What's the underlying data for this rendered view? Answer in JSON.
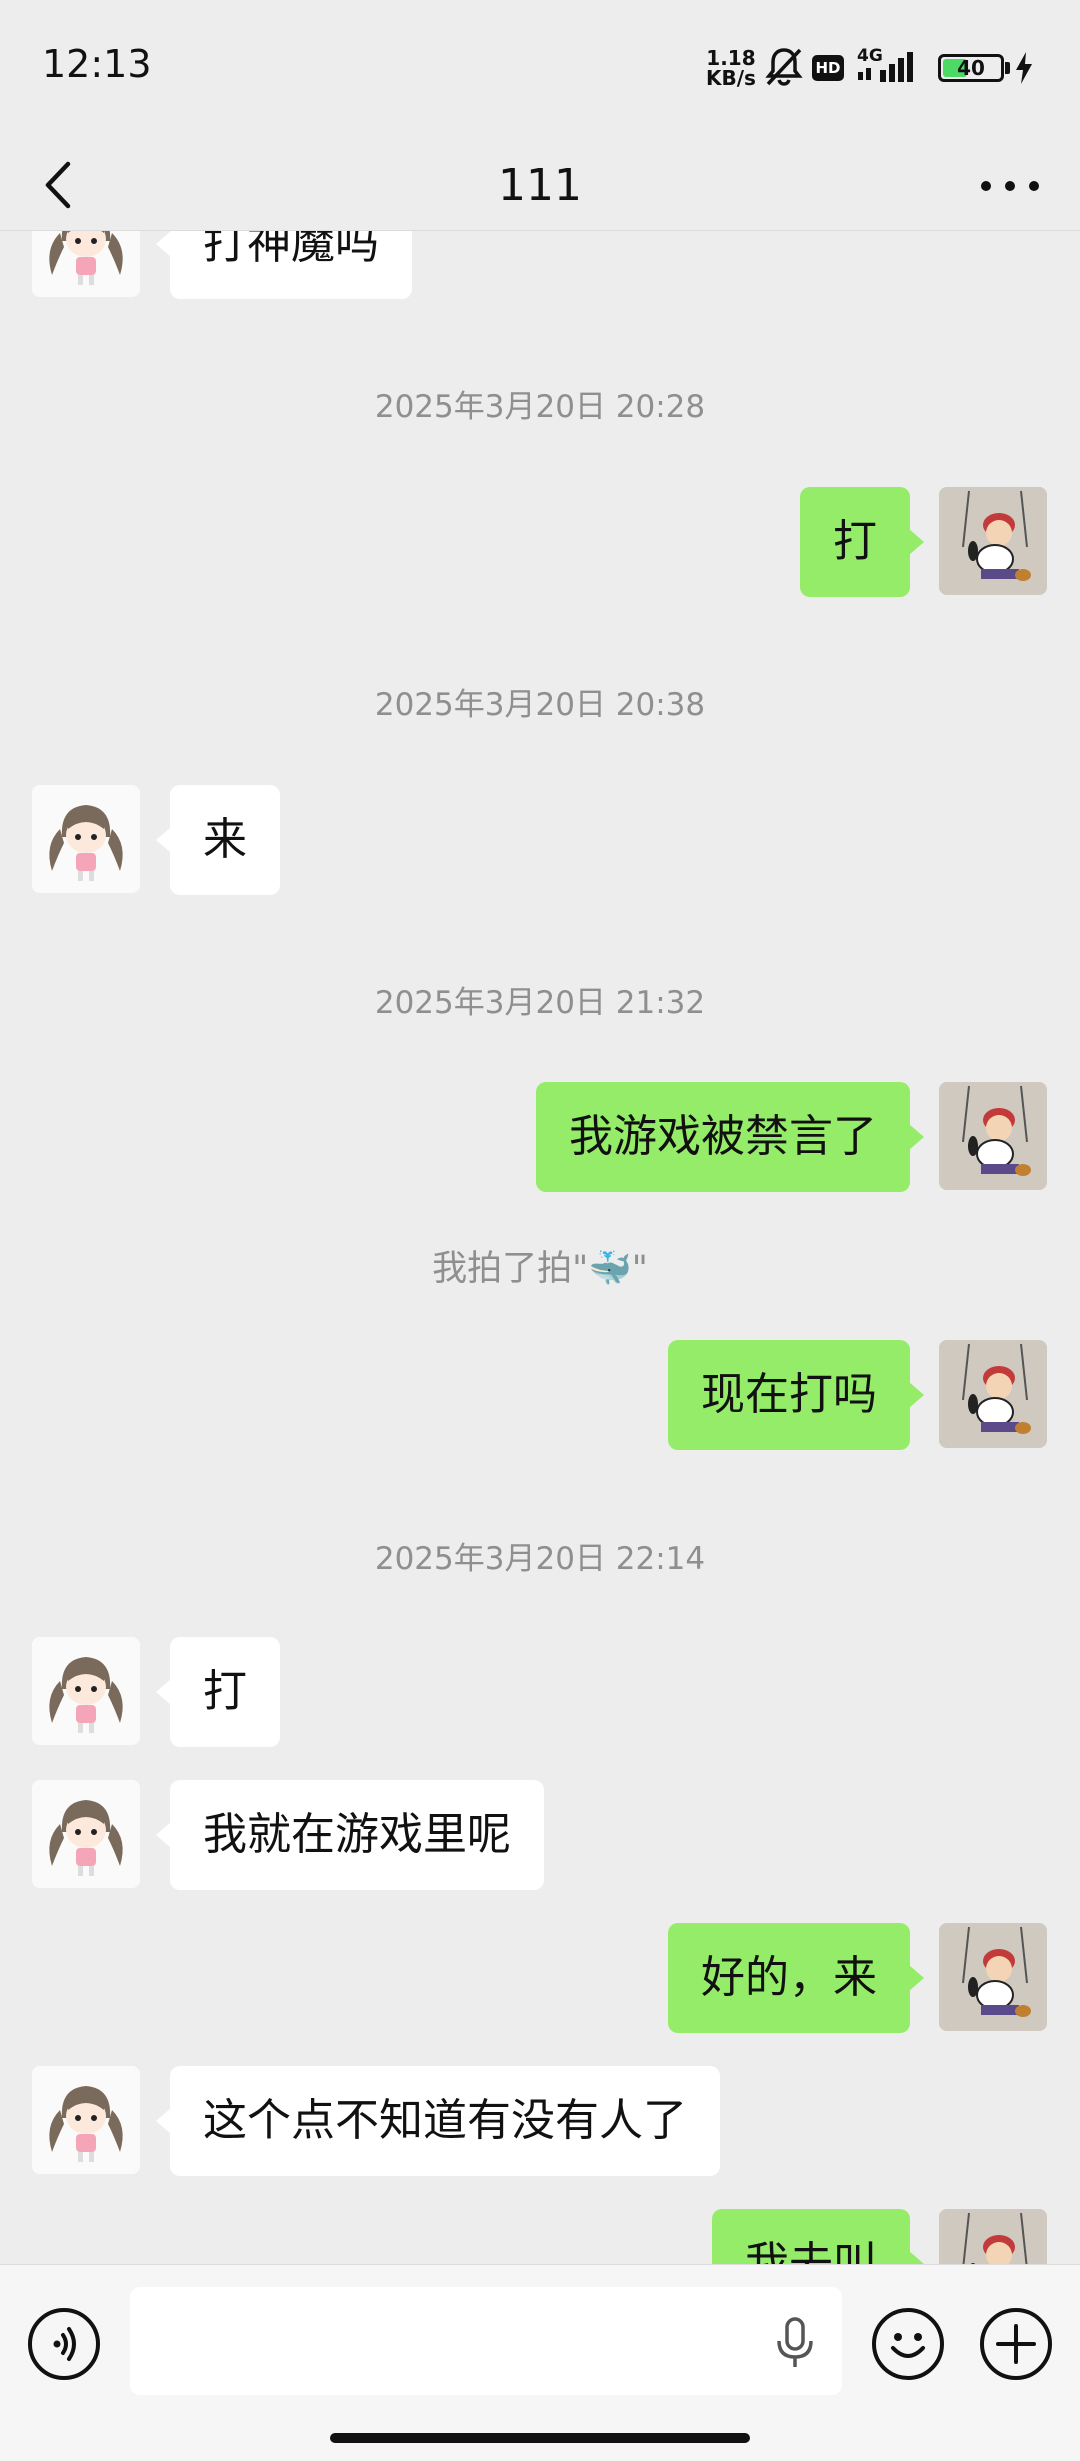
{
  "status_bar": {
    "time": "12:13",
    "net_speed_value": "1.18",
    "net_speed_unit": "KB/s",
    "hd_badge": "HD",
    "network_type": "4G",
    "battery_level": "40",
    "icons": [
      "mute-bell-icon",
      "hd-icon",
      "signal-icon",
      "battery-icon",
      "charging-icon"
    ]
  },
  "nav": {
    "title": "111",
    "back_icon": "chevron-left-icon",
    "more_icon": "more-dots-icon"
  },
  "colors": {
    "background": "#ededed",
    "incoming_bubble": "#ffffff",
    "outgoing_bubble": "#95ec69",
    "timestamp_text": "#8f8f8f"
  },
  "messages": {
    "m0": "打神魔吗",
    "t1": "2025年3月20日 20:28",
    "m1": "打",
    "t2": "2025年3月20日 20:38",
    "m2": "来",
    "t3": "2025年3月20日 21:32",
    "m3": "我游戏被禁言了",
    "sys1": "我拍了拍\"🐳\"",
    "m4": "现在打吗",
    "t4": "2025年3月20日 22:14",
    "m5": "打",
    "m6": "我就在游戏里呢",
    "m7": "好的，来",
    "m8": "这个点不知道有没有人了",
    "m9": "我去叫"
  },
  "input_bar": {
    "voice_icon": "voice-toggle-icon",
    "mic_icon": "microphone-icon",
    "emoji_icon": "emoji-icon",
    "plus_icon": "plus-icon",
    "input_value": ""
  }
}
